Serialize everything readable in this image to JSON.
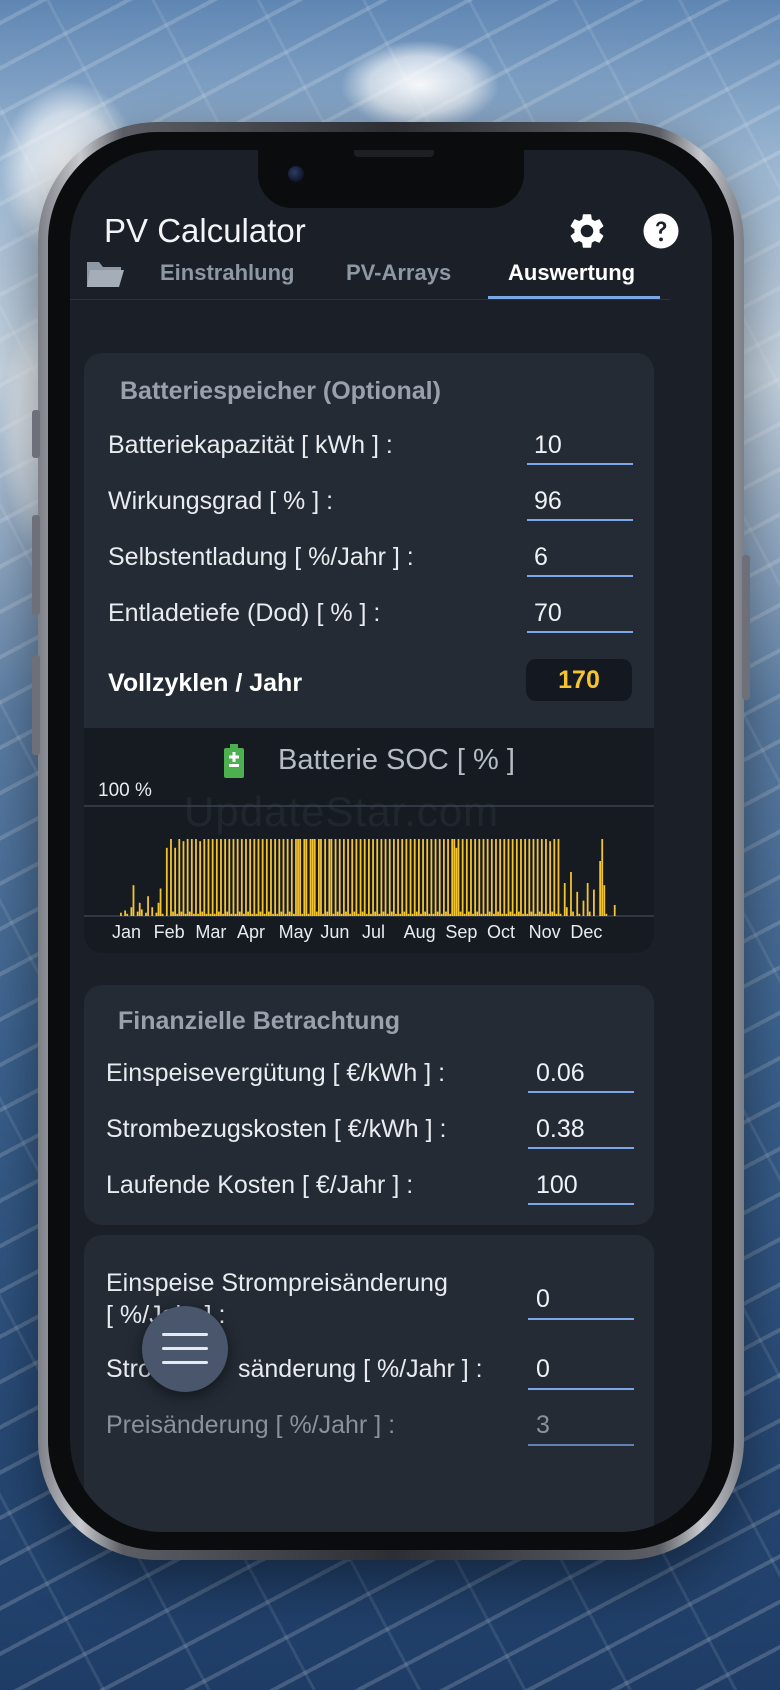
{
  "app": {
    "title": "PV Calculator",
    "icons": [
      "folder-icon",
      "gear-icon",
      "help-icon"
    ]
  },
  "tabs": [
    {
      "label": "Einstrahlung",
      "active": false
    },
    {
      "label": "PV-Arrays",
      "active": false
    },
    {
      "label": "Auswertung",
      "active": true
    }
  ],
  "battery": {
    "section_title": "Batteriespeicher (Optional)",
    "rows": [
      {
        "label": "Batteriekapazität  [ kWh ] :",
        "value": "10"
      },
      {
        "label": "Wirkungsgrad  [ % ] :",
        "value": "96"
      },
      {
        "label": "Selbstentladung  [ %/Jahr ] :",
        "value": "6"
      },
      {
        "label": "Entladetiefe (Dod)  [ % ] :",
        "value": "70"
      }
    ],
    "cycles_label": "Vollzyklen / Jahr",
    "cycles_value": "170"
  },
  "chart_data": {
    "type": "bar",
    "title": "Batterie SOC  [ % ]",
    "ylabel": "100 %",
    "ylim": [
      0,
      100
    ],
    "categories": [
      "Jan",
      "Feb",
      "Mar",
      "Apr",
      "May",
      "Jun",
      "Jul",
      "Aug",
      "Sep",
      "Oct",
      "Nov",
      "Dec"
    ],
    "series": [
      {
        "color": "#f5c431",
        "values": [
          0,
          3,
          0,
          5,
          2,
          0,
          8,
          28,
          0,
          4,
          12,
          6,
          0,
          3,
          18,
          0,
          8,
          0,
          3,
          12,
          25,
          2,
          0,
          62,
          0,
          70,
          4,
          62,
          2,
          70,
          4,
          68,
          2,
          70,
          4,
          70,
          2,
          70,
          2,
          68,
          4,
          70,
          2,
          70,
          2,
          70,
          2,
          70,
          4,
          70,
          2,
          70,
          4,
          70,
          2,
          70,
          2,
          70,
          4,
          70,
          2,
          70,
          4,
          70,
          2,
          70,
          2,
          70,
          4,
          70,
          2,
          70,
          4,
          70,
          2,
          70,
          2,
          70,
          4,
          70,
          2,
          70,
          4,
          70,
          2,
          70,
          70,
          70,
          2,
          70,
          70,
          2,
          70,
          70,
          70,
          4,
          70,
          70,
          2,
          70,
          4,
          70,
          70,
          2,
          70,
          4,
          70,
          2,
          70,
          4,
          70,
          2,
          70,
          4,
          70,
          2,
          70,
          4,
          70,
          2,
          70,
          2,
          70,
          4,
          70,
          2,
          70,
          4,
          70,
          2,
          70,
          4,
          70,
          2,
          70,
          2,
          70,
          4,
          70,
          2,
          70,
          2,
          70,
          4,
          70,
          2,
          70,
          4,
          70,
          2,
          70,
          2,
          70,
          4,
          70,
          2,
          70,
          4,
          70,
          2,
          70,
          70,
          62,
          70,
          4,
          70,
          2,
          70,
          4,
          70,
          2,
          70,
          4,
          70,
          2,
          70,
          2,
          70,
          4,
          70,
          2,
          70,
          4,
          70,
          2,
          70,
          2,
          70,
          4,
          70,
          2,
          70,
          4,
          70,
          2,
          70,
          2,
          70,
          4,
          70,
          2,
          70,
          4,
          70,
          2,
          70,
          2,
          68,
          4,
          70,
          2,
          70,
          2,
          0,
          30,
          8,
          0,
          40,
          4,
          0,
          22,
          2,
          0,
          14,
          0,
          30,
          4,
          0,
          24,
          0,
          0,
          50,
          70,
          28,
          2,
          0,
          0,
          0,
          10,
          0
        ]
      }
    ]
  },
  "finance": {
    "section_title": "Finanzielle Betrachtung",
    "rows": [
      {
        "label": "Einspeisevergütung  [ €/kWh ] :",
        "value": "0.06"
      },
      {
        "label": "Strombezugskosten  [ €/kWh ] :",
        "value": "0.38"
      },
      {
        "label": "Laufende Kosten  [ €/Jahr ] :",
        "value": "100"
      }
    ]
  },
  "price_change": {
    "row1_label_line1": "Einspeise Strompreisänderung",
    "row1_label_line2": "[ %/Jahr ] :",
    "row1_value": "0",
    "row2_label_start": "Stro",
    "row2_label_end": "sänderung  [ %/Jahr ] :",
    "row2_value": "0",
    "row3_label": "Preisänderung  [ %/Jahr ] :",
    "row3_value": "3"
  },
  "watermark": "UpdateStar.com",
  "colors": {
    "accent": "#7aa7e8",
    "highlight": "#f5c431",
    "card": "#242b35",
    "screen": "#1b2028"
  }
}
